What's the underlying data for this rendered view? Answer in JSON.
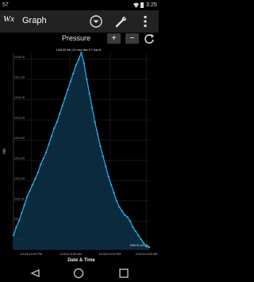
{
  "status_bar": {
    "left_text": "57",
    "time": "3:25"
  },
  "app": {
    "logo_text": "Wx",
    "title": "Graph"
  },
  "graph": {
    "title": "Pressure",
    "zoom_in": "+",
    "zoom_out": "−"
  },
  "icons": {
    "dropdown": "chevron-down-circle-icon",
    "wrench": "wrench-icon",
    "overflow": "overflow-menu-icon",
    "refresh": "refresh-icon",
    "back": "back-icon",
    "home": "home-icon",
    "recents": "recents-icon"
  },
  "colors": {
    "line": "#29a9e1",
    "fill": "#0c2f45",
    "background": "#000000",
    "grid": "#2a2a2a"
  },
  "chart_data": {
    "type": "area",
    "ylabel": "mb",
    "xlabel": "Date & Time",
    "ylim": [
      1008.8,
      1018.5
    ],
    "yticks": [
      {
        "value": 1009.2,
        "label": "1009.20"
      },
      {
        "value": 1010.2,
        "label": "1010.20"
      },
      {
        "value": 1011.2,
        "label": "1011.20"
      },
      {
        "value": 1012.2,
        "label": "1012.20"
      },
      {
        "value": 1013.2,
        "label": "1013.20"
      },
      {
        "value": 1014.2,
        "label": "1014.20"
      },
      {
        "value": 1015.2,
        "label": "1015.20"
      },
      {
        "value": 1016.2,
        "label": "1016.20"
      },
      {
        "value": 1017.2,
        "label": "1017.20"
      },
      {
        "value": 1018.2,
        "label": "1018.20"
      }
    ],
    "xlim": [
      0,
      100
    ],
    "xticks": [
      {
        "value": 13,
        "label": "1/12/14 6:00 PM"
      },
      {
        "value": 42,
        "label": "1/13/14 6:00 AM"
      },
      {
        "value": 71,
        "label": "1/13/14 6:00 PM"
      },
      {
        "value": 98,
        "label": "1/14/14 6:00 AM"
      }
    ],
    "annotations": [
      {
        "text": "1018.53 mb | 24 Hour Max 8.7 Day M",
        "x": 48,
        "y": 1018.53
      },
      {
        "text": "1008.91 mb (24",
        "x": 96,
        "y": 1008.91
      }
    ],
    "x": [
      0,
      2,
      4,
      6,
      8,
      10,
      12,
      14,
      16,
      18,
      20,
      22,
      24,
      26,
      28,
      30,
      32,
      34,
      36,
      38,
      40,
      42,
      44,
      46,
      48,
      50,
      52,
      54,
      56,
      58,
      60,
      62,
      64,
      66,
      68,
      70,
      72,
      74,
      76,
      78,
      80,
      82,
      84,
      86,
      88,
      90,
      92,
      94,
      96,
      98,
      100
    ],
    "y": [
      1009.5,
      1009.9,
      1010.2,
      1010.6,
      1011.0,
      1011.4,
      1011.7,
      1012.0,
      1012.3,
      1012.6,
      1013.0,
      1013.3,
      1013.6,
      1014.0,
      1014.4,
      1014.8,
      1015.1,
      1015.5,
      1015.9,
      1016.3,
      1016.7,
      1017.1,
      1017.5,
      1017.9,
      1018.2,
      1018.53,
      1018.0,
      1017.2,
      1016.5,
      1015.8,
      1015.1,
      1014.5,
      1013.9,
      1013.4,
      1012.9,
      1012.4,
      1012.0,
      1011.6,
      1011.2,
      1010.9,
      1010.7,
      1010.5,
      1010.4,
      1010.2,
      1009.9,
      1009.7,
      1009.5,
      1009.3,
      1009.1,
      1008.95,
      1008.91
    ]
  }
}
